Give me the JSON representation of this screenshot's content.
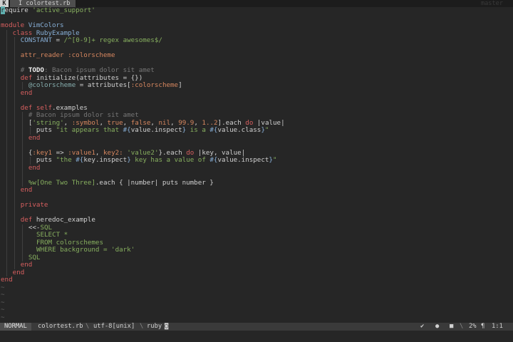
{
  "tabline": {
    "icon": "K",
    "active_tab": "I colortest.rb",
    "right_label": "master"
  },
  "code": [
    [
      [
        "cursor",
        "r"
      ],
      [
        "",
        "equire "
      ],
      [
        "str",
        "'active_support'"
      ]
    ],
    [],
    [
      [
        "kw",
        "module"
      ],
      [
        "",
        " "
      ],
      [
        "const",
        "VimColors"
      ]
    ],
    [
      [
        "",
        " "
      ],
      [
        "kw",
        "class"
      ],
      [
        "",
        " "
      ],
      [
        "const",
        "RubyExample"
      ]
    ],
    [
      [
        "",
        " "
      ],
      [
        "const",
        "CONSTANT"
      ],
      [
        "",
        " = "
      ],
      [
        "str",
        "/^[0-9]+ regex awesomes$/"
      ]
    ],
    [],
    [
      [
        "",
        " "
      ],
      [
        "sym",
        "attr_reader :colorscheme"
      ]
    ],
    [],
    [
      [
        "",
        " "
      ],
      [
        "cmt",
        "# "
      ],
      [
        "todo",
        "TODO"
      ],
      [
        "cmt",
        ": Bacon ipsum dolor sit amet"
      ]
    ],
    [
      [
        "",
        " "
      ],
      [
        "kw",
        "def"
      ],
      [
        "",
        " initialize(attributes = {})"
      ]
    ],
    [
      [
        "",
        " "
      ],
      [
        "ivar",
        "@colorscheme"
      ],
      [
        "",
        " = attributes["
      ],
      [
        "sym",
        ":colorscheme"
      ],
      [
        "",
        "]"
      ]
    ],
    [
      [
        "",
        " "
      ],
      [
        "kw",
        "end"
      ]
    ],
    [],
    [
      [
        "",
        " "
      ],
      [
        "kw",
        "def"
      ],
      [
        "",
        " "
      ],
      [
        "kw",
        "self"
      ],
      [
        "",
        ".examples"
      ]
    ],
    [
      [
        "",
        " "
      ],
      [
        "cmt",
        "# Bacon ipsum dolor sit amet"
      ]
    ],
    [
      [
        "",
        " ["
      ],
      [
        "str",
        "'string'"
      ],
      [
        "",
        ", "
      ],
      [
        "sym",
        ":symbol"
      ],
      [
        "",
        ", "
      ],
      [
        "sym",
        "true"
      ],
      [
        "",
        ", "
      ],
      [
        "sym",
        "false"
      ],
      [
        "",
        ", "
      ],
      [
        "sym",
        "nil"
      ],
      [
        "",
        ", "
      ],
      [
        "sym",
        "99.9"
      ],
      [
        "",
        ", "
      ],
      [
        "sym",
        "1..2"
      ],
      [
        "",
        "].each "
      ],
      [
        "kw",
        "do"
      ],
      [
        "",
        " |value|"
      ]
    ],
    [
      [
        "",
        " puts "
      ],
      [
        "str",
        "\"it appears that "
      ],
      [
        "interp",
        "#{"
      ],
      [
        "",
        "value.inspect"
      ],
      [
        "interp",
        "}"
      ],
      [
        "str",
        " is a "
      ],
      [
        "interp",
        "#{"
      ],
      [
        "",
        "value.class"
      ],
      [
        "interp",
        "}"
      ],
      [
        "str",
        "\""
      ]
    ],
    [
      [
        "",
        " "
      ],
      [
        "kw",
        "end"
      ]
    ],
    [],
    [
      [
        "",
        " {"
      ],
      [
        "sym",
        ":key1"
      ],
      [
        "",
        " => "
      ],
      [
        "sym",
        ":value1"
      ],
      [
        "",
        ", "
      ],
      [
        "sym",
        "key2:"
      ],
      [
        "",
        " "
      ],
      [
        "str",
        "'value2'"
      ],
      [
        "",
        "}.each "
      ],
      [
        "kw",
        "do"
      ],
      [
        "",
        " |key, value|"
      ]
    ],
    [
      [
        "",
        " puts "
      ],
      [
        "str",
        "\"the "
      ],
      [
        "interp",
        "#{"
      ],
      [
        "",
        "key.inspect"
      ],
      [
        "interp",
        "}"
      ],
      [
        "str",
        " key has a value of "
      ],
      [
        "interp",
        "#{"
      ],
      [
        "",
        "value.inspect"
      ],
      [
        "interp",
        "}"
      ],
      [
        "str",
        "\""
      ]
    ],
    [
      [
        "",
        " "
      ],
      [
        "kw",
        "end"
      ]
    ],
    [],
    [
      [
        "",
        " "
      ],
      [
        "str",
        "%w[One Two Three]"
      ],
      [
        "",
        ".each { |number| puts number }"
      ]
    ],
    [
      [
        "",
        " "
      ],
      [
        "kw",
        "end"
      ]
    ],
    [],
    [
      [
        "",
        " "
      ],
      [
        "kw",
        "private"
      ]
    ],
    [],
    [
      [
        "",
        " "
      ],
      [
        "kw",
        "def"
      ],
      [
        "",
        " heredoc_example"
      ]
    ],
    [
      [
        "",
        " <<-"
      ],
      [
        "str",
        "SQL"
      ]
    ],
    [
      [
        "",
        " "
      ],
      [
        "str",
        "SELECT *"
      ]
    ],
    [
      [
        "",
        " "
      ],
      [
        "str",
        "FROM colorschemes"
      ]
    ],
    [
      [
        "",
        " "
      ],
      [
        "str",
        "WHERE background = 'dark'"
      ]
    ],
    [
      [
        "",
        " "
      ],
      [
        "str",
        "SQL"
      ]
    ],
    [
      [
        "",
        " "
      ],
      [
        "kw",
        "end"
      ]
    ],
    [
      [
        "",
        " "
      ],
      [
        "kw",
        "end"
      ]
    ],
    [
      [
        "kw",
        "end"
      ]
    ],
    [
      [
        "tilde",
        "~"
      ]
    ],
    [
      [
        "tilde",
        "~"
      ]
    ],
    [
      [
        "tilde",
        "~"
      ]
    ],
    [
      [
        "tilde",
        "~"
      ]
    ],
    [
      [
        "tilde",
        "~"
      ]
    ]
  ],
  "status": {
    "mode": "NORMAL",
    "filename": "colortest.rb",
    "sep1": "\\",
    "encoding": "utf-8[unix]",
    "sep2": "\\",
    "filetype": "ruby",
    "filetype_icon": "◙",
    "check_icon": "✔",
    "dot_icon": "●",
    "square_icon": "■",
    "sep3": "\\",
    "percent": "2%",
    "line_icon": "¶",
    "position": "1:1"
  },
  "colors": {
    "background": "#262626",
    "keyword": "#d75f5f",
    "constant": "#87afd7",
    "string": "#87af5f",
    "symbol": "#d7875f",
    "comment": "#767676",
    "cursor": "#5fafaf"
  }
}
